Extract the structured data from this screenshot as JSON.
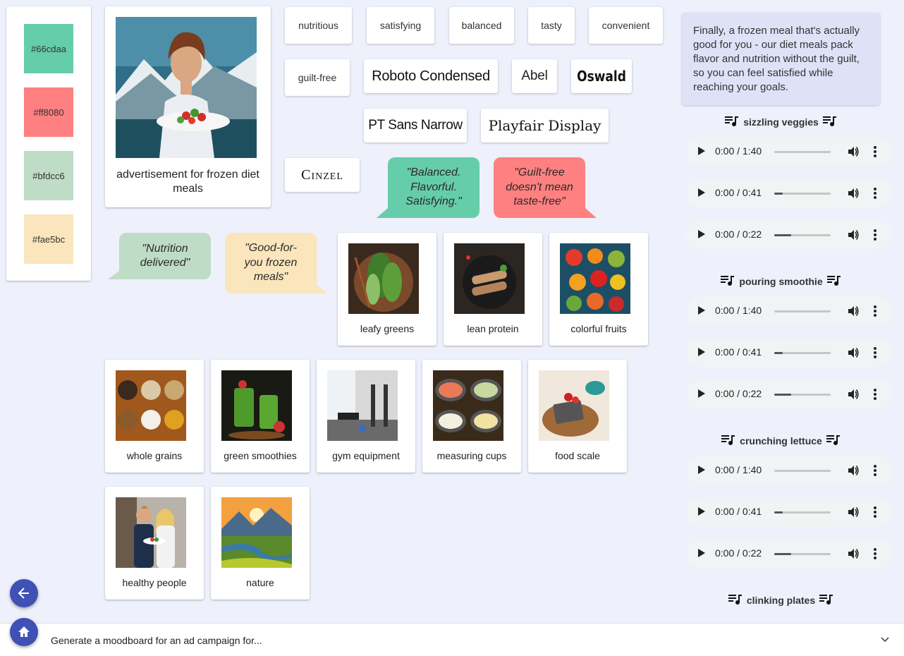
{
  "palette": [
    {
      "hex": "#66cdaa",
      "label": "#66cdaa"
    },
    {
      "hex": "#ff8080",
      "label": "#ff8080"
    },
    {
      "hex": "#bfdcc6",
      "label": "#bfdcc6"
    },
    {
      "hex": "#fae5bc",
      "label": "#fae5bc"
    }
  ],
  "hero": {
    "caption": "advertisement for frozen diet meals"
  },
  "keywords": [
    "nutritious",
    "satisfying",
    "balanced",
    "tasty",
    "convenient",
    "guilt-free"
  ],
  "fonts": [
    "Roboto Condensed",
    "Abel",
    "Oswald",
    "PT Sans Narrow",
    "Playfair Display",
    "Cinzel"
  ],
  "quotes": [
    {
      "text": "\"Balanced. Flavorful. Satisfying.\"",
      "color": "#66cdaa"
    },
    {
      "text": "\"Guilt-free doesn't mean taste-free\"",
      "color": "#ff8080"
    },
    {
      "text": "\"Nutrition delivered\"",
      "color": "#bfdcc6"
    },
    {
      "text": "\"Good-for-you frozen meals\"",
      "color": "#fae5bc"
    }
  ],
  "images": [
    {
      "label": "leafy greens",
      "icon": "leafy-greens-image"
    },
    {
      "label": "lean protein",
      "icon": "lean-protein-image"
    },
    {
      "label": "colorful fruits",
      "icon": "colorful-fruits-image"
    },
    {
      "label": "whole grains",
      "icon": "whole-grains-image"
    },
    {
      "label": "green smoothies",
      "icon": "green-smoothies-image"
    },
    {
      "label": "gym equipment",
      "icon": "gym-equipment-image"
    },
    {
      "label": "measuring cups",
      "icon": "measuring-cups-image"
    },
    {
      "label": "food scale",
      "icon": "food-scale-image"
    },
    {
      "label": "healthy people",
      "icon": "healthy-people-image"
    },
    {
      "label": "nature",
      "icon": "nature-image"
    }
  ],
  "tagline": "Finally, a frozen meal that's actually good for you - our diet meals pack flavor and nutrition without the guilt, so you can feel satisfied while reaching your goals.",
  "sounds": [
    {
      "title": "sizzling veggies",
      "players": [
        {
          "time": "0:00 / 1:40",
          "progress": 0.0
        },
        {
          "time": "0:00 / 0:41",
          "progress": 0.15
        },
        {
          "time": "0:00 / 0:22",
          "progress": 0.3
        }
      ]
    },
    {
      "title": "pouring smoothie",
      "players": [
        {
          "time": "0:00 / 1:40",
          "progress": 0.0
        },
        {
          "time": "0:00 / 0:41",
          "progress": 0.15
        },
        {
          "time": "0:00 / 0:22",
          "progress": 0.3
        }
      ]
    },
    {
      "title": "crunching lettuce",
      "players": [
        {
          "time": "0:00 / 1:40",
          "progress": 0.0
        },
        {
          "time": "0:00 / 0:41",
          "progress": 0.15
        },
        {
          "time": "0:00 / 0:22",
          "progress": 0.3
        }
      ]
    },
    {
      "title": "clinking plates",
      "players": []
    }
  ],
  "bottom": {
    "prompt": "Generate a moodboard for an ad campaign for..."
  },
  "colors": {
    "accent": "#3f51b5",
    "background": "#eef0fb",
    "tagline_bg": "#dfe2f7"
  }
}
